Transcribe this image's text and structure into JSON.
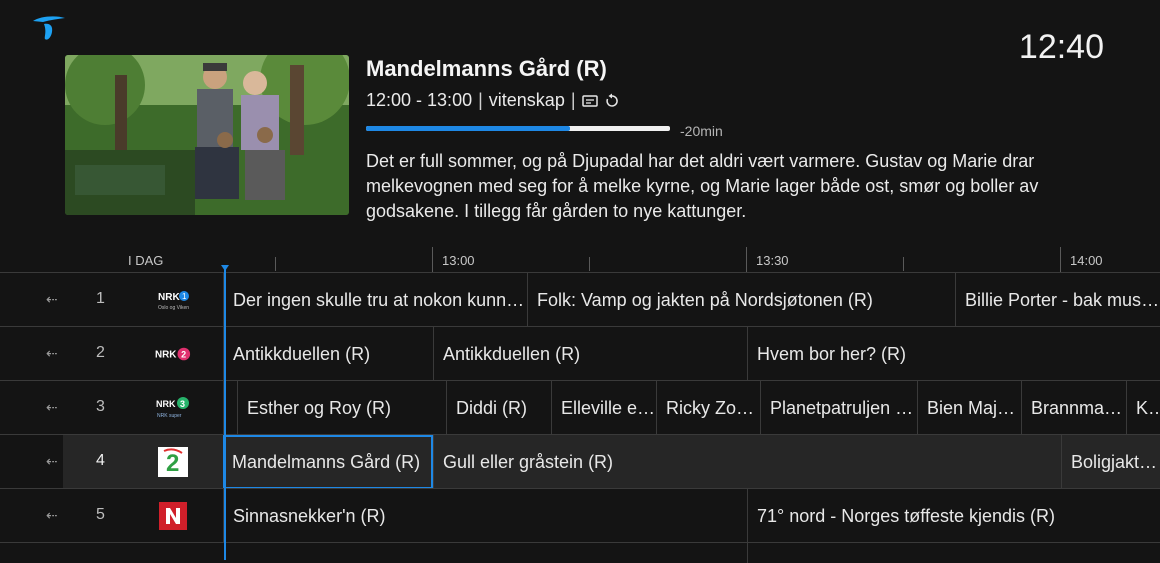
{
  "clock": "12:40",
  "detail": {
    "title": "Mandelmanns Gård (R)",
    "time": "12:00 - 13:00",
    "genre": "vitenskap",
    "icons": [
      "subtitles-icon",
      "replay-icon"
    ],
    "progress": 0.67,
    "remaining": "-20min",
    "description": "Det er full sommer, og på Djupadal har det aldri vært varmere. Gustav og Marie drar melkevognen med seg for å melke kyrne, og Marie lager både ost, smør og boller av godsakene. I tillegg får gården to nye kattunger."
  },
  "timeline": {
    "today": "I DAG",
    "ticks": [
      "13:00",
      "13:30",
      "14:00"
    ]
  },
  "channels": [
    {
      "num": "1",
      "logo": "nrk1-logo",
      "programs": [
        "Der ingen skulle tru at nokon kunne bu",
        "Folk: Vamp og jakten på Nordsjøtonen (R)",
        "Billie Porter - bak musikken"
      ]
    },
    {
      "num": "2",
      "logo": "nrk2-logo",
      "programs": [
        "Antikkduellen (R)",
        "Antikkduellen (R)",
        "Hvem bor her? (R)"
      ]
    },
    {
      "num": "3",
      "logo": "nrk3-logo",
      "programs": [
        "",
        "Esther og Roy (R)",
        "Diddi (R)",
        "Elleville elefanter",
        "Ricky Zoom",
        "Planetpatruljen (R)",
        "Bien Maja (R)",
        "Brannmann Sam",
        "Kos"
      ]
    },
    {
      "num": "4",
      "logo": "tv2-logo",
      "programs": [
        "Mandelmanns Gård (R)",
        "Gull eller gråstein (R)",
        "Boligjakt i ..."
      ]
    },
    {
      "num": "5",
      "logo": "tvnorge-logo",
      "programs": [
        "Sinnasnekker'n (R)",
        "71° nord - Norges tøffeste kjendis (R)"
      ]
    }
  ]
}
